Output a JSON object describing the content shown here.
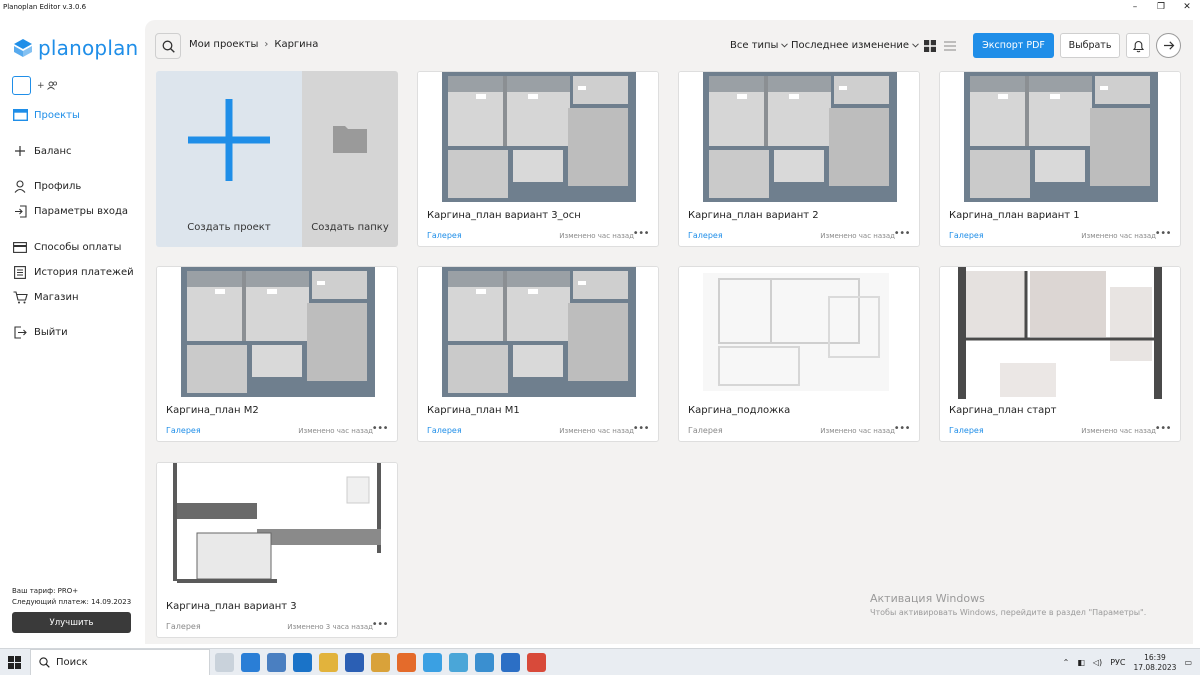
{
  "window": {
    "title": "Planoplan Editor v.3.0.6",
    "controls": [
      "–",
      "❐",
      "✕"
    ]
  },
  "sidebar": {
    "logo_text": "planoplan",
    "add_user_label": "+",
    "items": [
      {
        "label": "Проекты",
        "icon": "projects-icon",
        "active": true
      },
      {
        "label": "Баланс",
        "icon": "plus-icon",
        "active": false
      },
      {
        "label": "Профиль",
        "icon": "user-icon",
        "active": false
      },
      {
        "label": "Параметры входа",
        "icon": "login-icon",
        "active": false
      },
      {
        "label": "Способы оплаты",
        "icon": "card-icon",
        "active": false
      },
      {
        "label": "История платежей",
        "icon": "history-icon",
        "active": false
      },
      {
        "label": "Магазин",
        "icon": "cart-icon",
        "active": false
      },
      {
        "label": "Выйти",
        "icon": "logout-icon",
        "active": false
      }
    ],
    "tariff_label": "Ваш тариф:",
    "tariff_value": "PRO+",
    "next_payment_label": "Следующий платеж:",
    "next_payment_value": "14.09.2023",
    "upgrade_label": "Улучшить"
  },
  "topbar": {
    "breadcrumb_root": "Мои проекты",
    "breadcrumb_sep": "›",
    "breadcrumb_current": "Каргина",
    "filter_types": "Все типы",
    "filter_sort": "Последнее изменение",
    "export_label": "Экспорт PDF",
    "select_label": "Выбрать"
  },
  "create_tile": {
    "create_label": "Создать проект",
    "folder_label": "Создать папку"
  },
  "cards": [
    {
      "name": "Каргина_план вариант 3_осн",
      "gallery": "Галерея",
      "gallery_active": true,
      "modified": "Изменено час назад",
      "style": "render"
    },
    {
      "name": "Каргина_план вариант 2",
      "gallery": "Галерея",
      "gallery_active": true,
      "modified": "Изменено час назад",
      "style": "render"
    },
    {
      "name": "Каргина_план вариант 1",
      "gallery": "Галерея",
      "gallery_active": true,
      "modified": "Изменено час назад",
      "style": "render"
    },
    {
      "name": "Каргина_план М2",
      "gallery": "Галерея",
      "gallery_active": true,
      "modified": "Изменено час назад",
      "style": "render"
    },
    {
      "name": "Каргина_план М1",
      "gallery": "Галерея",
      "gallery_active": true,
      "modified": "Изменено час назад",
      "style": "render"
    },
    {
      "name": "Каргина_подложка",
      "gallery": "Галерея",
      "gallery_active": false,
      "modified": "Изменено час назад",
      "style": "sketch"
    },
    {
      "name": "Каргина_план старт",
      "gallery": "Галерея",
      "gallery_active": true,
      "modified": "Изменено час назад",
      "style": "plan"
    },
    {
      "name": "Каргина_план вариант 3",
      "gallery": "Галерея",
      "gallery_active": false,
      "modified": "Изменено 3 часа назад",
      "style": "furniture"
    }
  ],
  "watermark": {
    "title": "Активация Windows",
    "subtitle": "Чтобы активировать Windows, перейдите в раздел \"Параметры\"."
  },
  "taskbar": {
    "search_placeholder": "Поиск",
    "lang": "РУС",
    "time": "16:39",
    "date": "17.08.2023"
  },
  "colors": {
    "accent": "#1f8ee8",
    "dark_button": "#3a3a3a",
    "main_bg": "#f3f2f1"
  }
}
